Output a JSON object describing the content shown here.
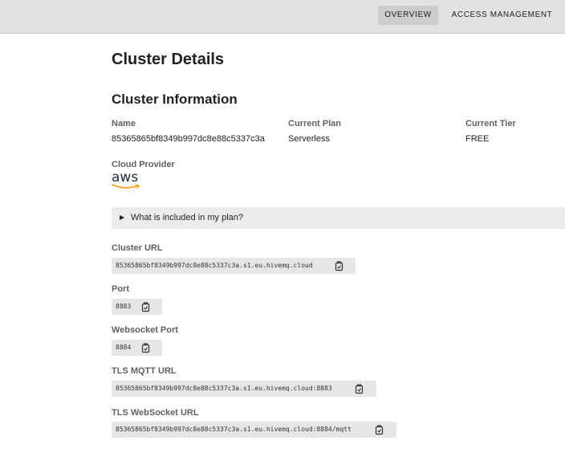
{
  "nav": {
    "tabs": [
      {
        "label": "OVERVIEW",
        "active": true
      },
      {
        "label": "ACCESS MANAGEMENT",
        "active": false
      }
    ]
  },
  "page": {
    "title": "Cluster Details",
    "section_title": "Cluster Information"
  },
  "cluster": {
    "name_label": "Name",
    "name_value": "85365865bf8349b997dc8e88c5337c3a",
    "plan_label": "Current Plan",
    "plan_value": "Serverless",
    "tier_label": "Current Tier",
    "tier_value": "FREE",
    "provider_label": "Cloud Provider",
    "provider_logo_text": "aws"
  },
  "expander": {
    "label": "What is included in my plan?"
  },
  "connection": {
    "cluster_url_label": "Cluster URL",
    "cluster_url_value": "85365865bf8349b997dc8e88c5337c3a.s1.eu.hivemq.cloud",
    "port_label": "Port",
    "port_value": "8883",
    "websocket_port_label": "Websocket Port",
    "websocket_port_value": "8884",
    "tls_mqtt_label": "TLS MQTT URL",
    "tls_mqtt_value": "85365865bf8349b997dc8e88c5337c3a.s1.eu.hivemq.cloud:8883",
    "tls_ws_label": "TLS WebSocket URL",
    "tls_ws_value": "85365865bf8349b997dc8e88c5337c3a.s1.eu.hivemq.cloud:8884/mqtt"
  },
  "icons": {
    "copy": "copy-icon",
    "expand": "triangle-right-icon",
    "provider_logo": "aws-logo"
  },
  "colors": {
    "topbar_bg": "#e2e2e2",
    "active_tab_bg": "#cdcdcd",
    "code_bg": "#e6e6e6",
    "aws_orange": "#ff9900"
  }
}
